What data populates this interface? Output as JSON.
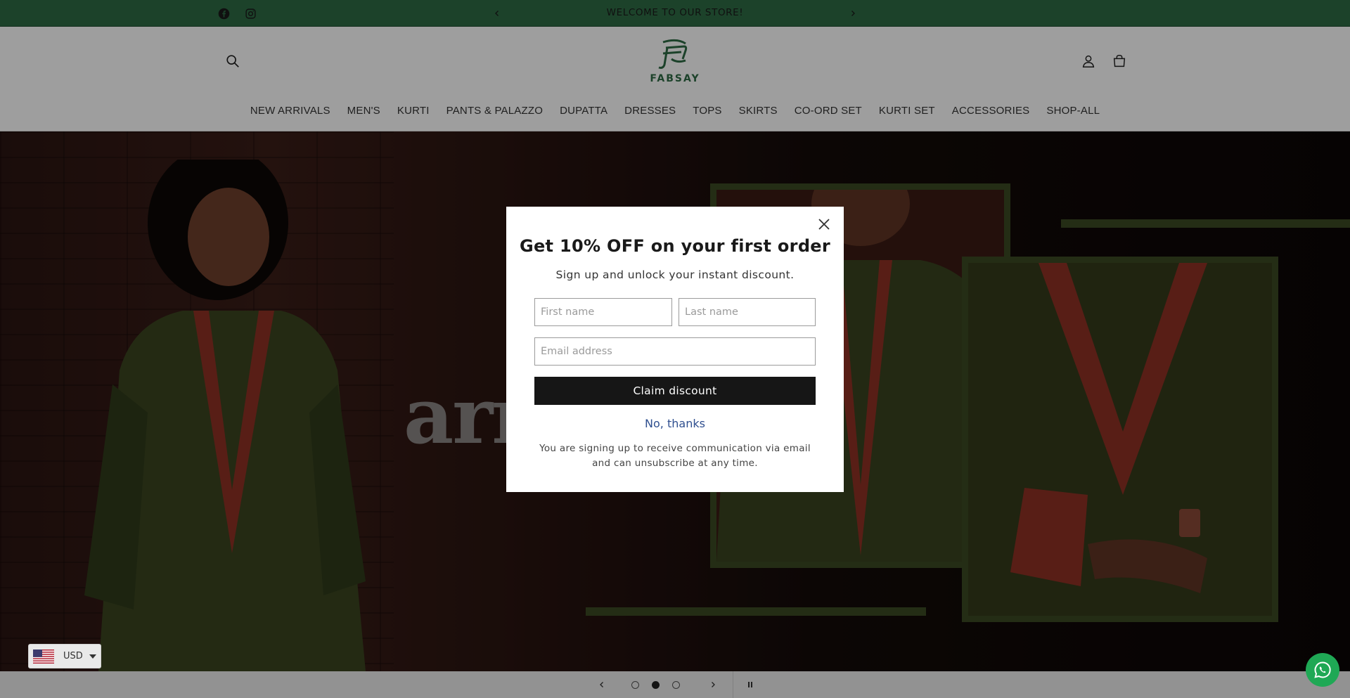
{
  "announcement": {
    "text": "WELCOME TO OUR STORE!",
    "background": "#2e6b45"
  },
  "social": [
    "facebook-icon",
    "instagram-icon"
  ],
  "header": {
    "brand": "FABSAY",
    "icons": [
      "search-icon",
      "account-icon",
      "cart-icon"
    ]
  },
  "nav": {
    "items": [
      "NEW ARRIVALS",
      "MEN'S",
      "KURTI",
      "PANTS & PALAZZO",
      "DUPATTA",
      "DRESSES",
      "TOPS",
      "SKIRTS",
      "CO-ORD SET",
      "KURTI SET",
      "ACCESSORIES",
      "SHOP-ALL"
    ]
  },
  "hero": {
    "word": "arr"
  },
  "slider": {
    "slides": 3,
    "active": 2
  },
  "currency": {
    "code": "USD"
  },
  "modal": {
    "title": "Get 10% OFF on your first order",
    "subtitle": "Sign up and unlock your instant discount.",
    "first_name_placeholder": "First name",
    "last_name_placeholder": "Last name",
    "email_placeholder": "Email address",
    "claim_label": "Claim discount",
    "decline_label": "No, thanks",
    "legal": "You are signing up to receive communication via email and can unsubscribe at any time."
  },
  "colors": {
    "accent": "#2e6b45",
    "button": "#161616",
    "link": "#2f4f8f",
    "whatsapp": "#1fa855"
  }
}
